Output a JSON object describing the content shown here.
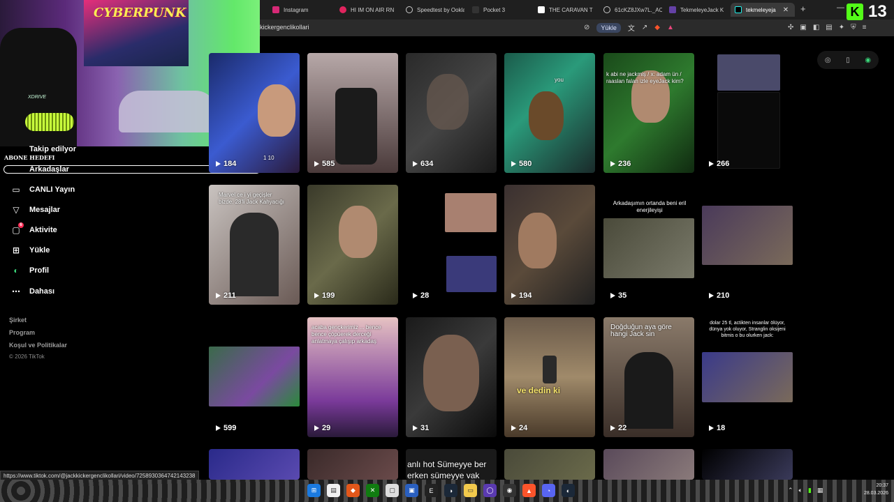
{
  "browser": {
    "tabs": [
      {
        "title": "Instagram",
        "color": "#d62976"
      },
      {
        "title": "HI IM ON AIR RN",
        "color": "#e0245e"
      },
      {
        "title": "Speedtest by Ookla",
        "color": "#444444"
      },
      {
        "title": "Pocket 3",
        "color": "#333333"
      },
      {
        "title": "THE CARAVAN T",
        "color": "#ffffff"
      },
      {
        "title": "61cKZ8JXw7L._AC",
        "color": "#555555"
      },
      {
        "title": "TekmeleyeJack K",
        "color": "#6441a5"
      },
      {
        "title": "tekmeleyeja",
        "color": "#000000"
      }
    ],
    "url": "kickergenclikollari",
    "upload_label": "Yükle",
    "status_url": "https://www.tiktok.com/@jackkickergenclikollari/video/7258930364742143238"
  },
  "overlay": {
    "poster_text": "CYBERPUNK",
    "chair_brand": "XDRIVE",
    "goal_label": "ABONE HEDEFI",
    "kick_count": "13"
  },
  "sidebar": {
    "items": [
      {
        "label": "Takip edilyor",
        "icon": "following-icon"
      },
      {
        "label": "Arkadaşlar",
        "icon": "friends-icon"
      },
      {
        "label": "CANLI Yayın",
        "icon": "live-icon"
      },
      {
        "label": "Mesajlar",
        "icon": "send-icon"
      },
      {
        "label": "Aktivite",
        "icon": "activity-icon",
        "badge": "6"
      },
      {
        "label": "Yükle",
        "icon": "upload-icon"
      },
      {
        "label": "Profil",
        "icon": "profile-icon"
      },
      {
        "label": "Dahası",
        "icon": "more-icon"
      }
    ],
    "footer": [
      "Şirket",
      "Program",
      "Koşul ve Politikalar"
    ],
    "copyright": "© 2026 TikTok"
  },
  "videos": [
    {
      "views": "184",
      "caption": "1 10"
    },
    {
      "views": "585",
      "caption": ""
    },
    {
      "views": "634",
      "caption": ""
    },
    {
      "views": "580",
      "caption": "you"
    },
    {
      "views": "236",
      "caption": "k abi ne jackmiş / x: adam ün / raaslan falan izle eyeJack kim?"
    },
    {
      "views": "266",
      "caption": ""
    },
    {
      "views": "211",
      "caption": "Marvel ce i yi geçişler bizde. 28'li Jack Kahyacığı"
    },
    {
      "views": "199",
      "caption": ""
    },
    {
      "views": "28",
      "caption": ""
    },
    {
      "views": "194",
      "caption": ""
    },
    {
      "views": "35",
      "caption": "Arkadaşımın ortanda beni eril enerjileyişi"
    },
    {
      "views": "210",
      "caption": ""
    },
    {
      "views": "599",
      "caption": ""
    },
    {
      "views": "29",
      "caption": "acaba gençkerimiz ... bence bence çöpüerek derceği anlatmaya çalışıp arkadaş"
    },
    {
      "views": "31",
      "caption": ""
    },
    {
      "views": "24",
      "caption": "ve dedin ki"
    },
    {
      "views": "22",
      "caption": "Doğduğun aya göre hangi Jack sin"
    },
    {
      "views": "18",
      "caption": "dolar 25 tl, actikten insanlar ölüyor, dünya yok oluyor, Stranglin oksijeni bitmis o bu olurken jack:"
    }
  ],
  "bottom_row_caption": "anlı hot Sümeyye ber erken sümeyye vak",
  "taskbar": {
    "time": "20:37",
    "date": "28.03.2026"
  }
}
